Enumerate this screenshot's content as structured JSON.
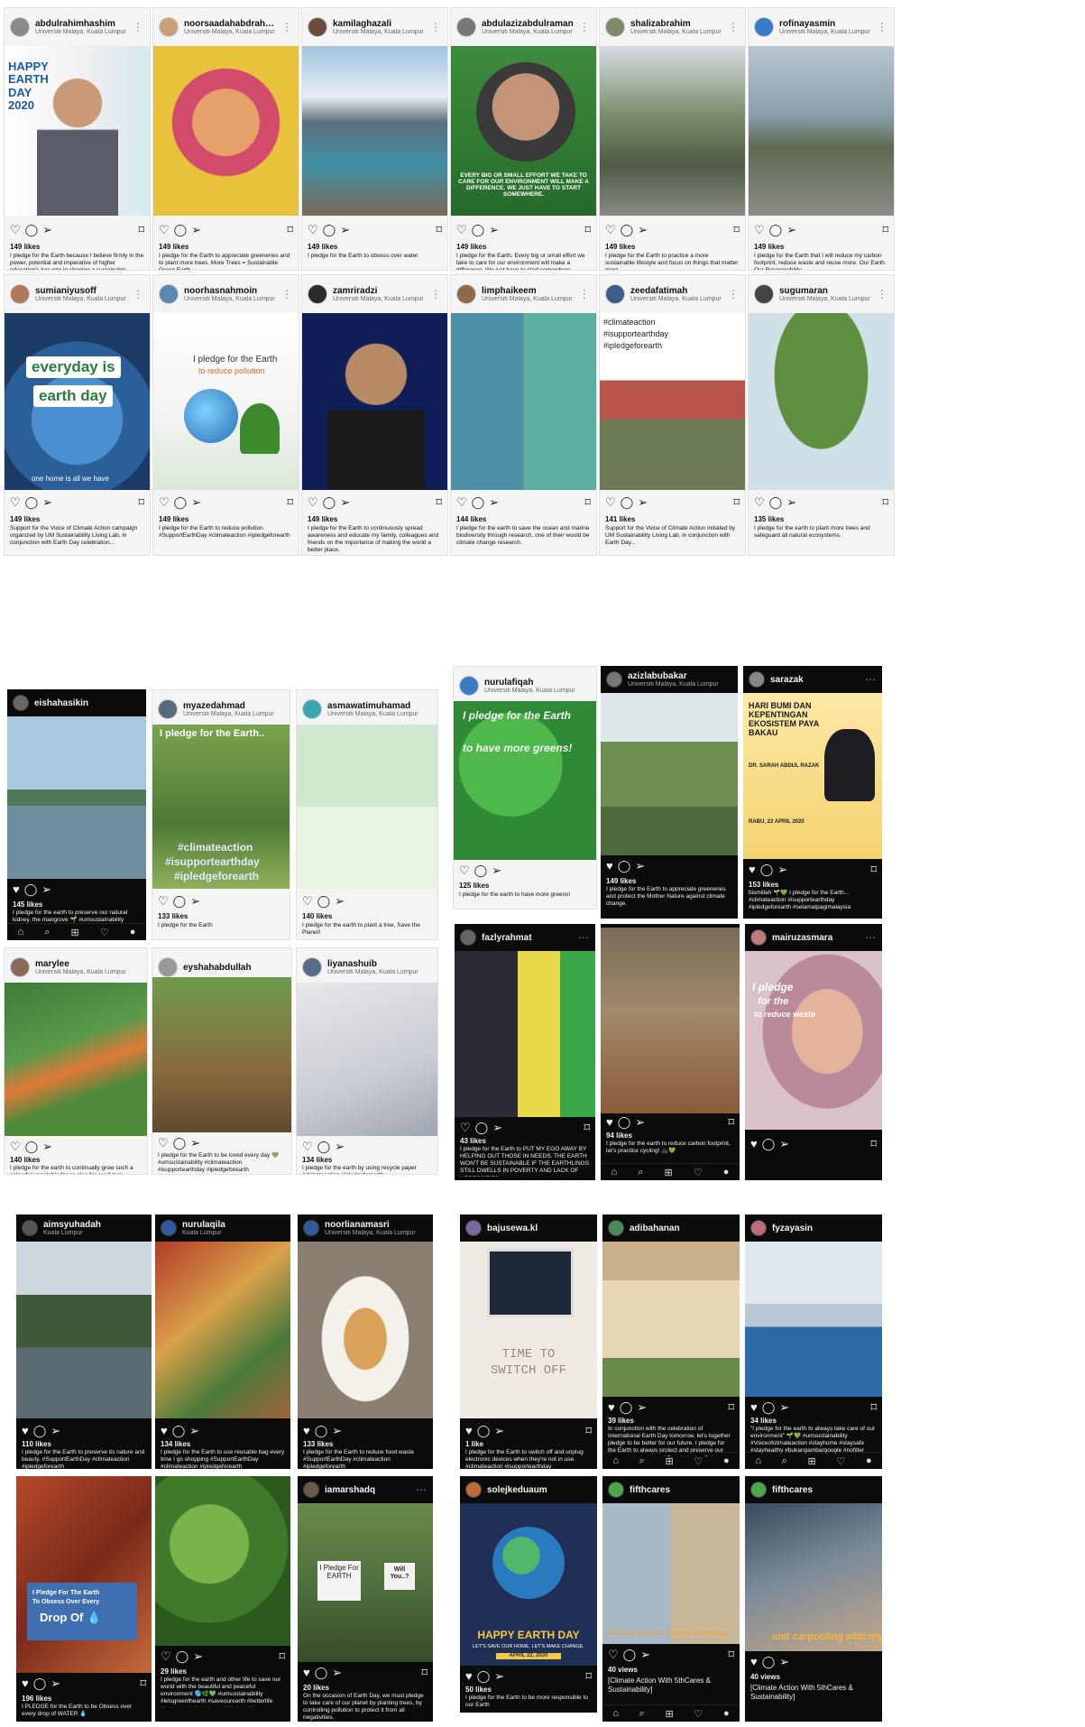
{
  "posts": [
    {
      "user": "abdulrahimhashim",
      "loc": "Universiti Malaya, Kuala Lumpur",
      "likes": "149 likes",
      "cap": "I pledge for the Earth because I believe firmly in the power, potential and imperative of higher education's key role in shaping a sustainable society. I believe that enabling leadership in making the necessary shift towards responsible and sustainable lifestyle is one of our mandates...",
      "overlays": [
        "HAPPY EARTH DAY 2020"
      ]
    },
    {
      "user": "noorsaadahabdrahman",
      "loc": "Universiti Malaya, Kuala Lumpur",
      "likes": "149 likes",
      "cap": "I pledge for the Earth to appreciate greeneries and to plant more trees. More Trees = Sustainable Green Earth",
      "overlays": []
    },
    {
      "user": "kamilaghazali",
      "loc": "Universiti Malaya, Kuala Lumpur",
      "likes": "149 likes",
      "cap": "I pledge for the Earth to obsess over water",
      "overlays": []
    },
    {
      "user": "abdulazizabdulraman",
      "loc": "Universiti Malaya, Kuala Lumpur",
      "likes": "149 likes",
      "cap": "I pledge for the Earth. Every big or small effort we take to care for our environment will make a difference. We just have to start somewhere.",
      "overlays": [
        "EVERY BIG OR SMALL EFFORT WE TAKE TO CARE FOR OUR ENVIRONMENT WILL MAKE A DIFFERENCE. WE JUST HAVE TO START SOMEWHERE."
      ]
    },
    {
      "user": "shalizabrahim",
      "loc": "Universiti Malaya, Kuala Lumpur",
      "likes": "149 likes",
      "cap": "I pledge for the Earth to practice a more sustainable lifestyle and focus on things that matter most.",
      "overlays": []
    },
    {
      "user": "rofinayasmin",
      "loc": "Universiti Malaya, Kuala Lumpur",
      "likes": "149 likes",
      "cap": "I pledge for the Earth that I will reduce my carbon footprint, reduce waste and reuse more. Our Earth. Our Responsibility.",
      "overlays": []
    },
    {
      "user": "sumianiyusoff",
      "loc": "Universiti Malaya, Kuala Lumpur",
      "likes": "149 likes",
      "cap": "Support for the Voice of Climate Action campaign organized by UM Sustainability Living Lab, in conjunction with Earth Day celebration...",
      "overlays": [
        "everyday is",
        "earth day",
        "one home is all we have"
      ]
    },
    {
      "user": "noorhasnahmoin",
      "loc": "Universiti Malaya, Kuala Lumpur",
      "likes": "149 likes",
      "cap": "I pledge for the Earth to reduce pollution. #SupportEarthDay #climateaction #ipledgeforearth",
      "overlays": [
        "I pledge for the Earth",
        "to reduce pollution"
      ]
    },
    {
      "user": "zamriradzi",
      "loc": "Universiti Malaya, Kuala Lumpur",
      "likes": "149 likes",
      "cap": "I pledge for the Earth to continuously spread awareness and educate my family, colleagues and friends on the importance of making the world a better place.",
      "overlays": []
    },
    {
      "user": "limphaikeem",
      "loc": "Universiti Malaya, Kuala Lumpur",
      "likes": "144 likes",
      "cap": "I pledge for the earth to save the ocean and marine biodiversity through research, one of their would be climate change research.",
      "overlays": []
    },
    {
      "user": "zeedafatimah",
      "loc": "Universiti Malaya, Kuala Lumpur",
      "likes": "141 likes",
      "cap": "Support for the Voice of Climate Action initiated by UM Sustainability Living Lab, in conjunction with Earth Day...",
      "overlays": [
        "#climateaction",
        "#isupportearthday",
        "#ipledgeforearth"
      ]
    },
    {
      "user": "sugumaran",
      "loc": "Universiti Malaya, Kuala Lumpur",
      "likes": "135 likes",
      "cap": "I pledge for the earth to plant more trees and safeguard all natural ecosystems.",
      "overlays": []
    },
    {
      "user": "eishahasikin",
      "loc": "",
      "likes": "145 likes",
      "cap": "I pledge for the earth to preserve our natural kidney, the mangrove 🌱 #umsustainability",
      "overlays": []
    },
    {
      "user": "myazedahmad",
      "loc": "Universiti Malaya, Kuala Lumpur",
      "likes": "133 likes",
      "cap": "I pledge for the Earth",
      "overlays": [
        "I pledge for the Earth..",
        "#climateaction",
        "#isupportearthday",
        "#ipledgeforearth"
      ]
    },
    {
      "user": "asmawatimuhamad",
      "loc": "Universiti Malaya, Kuala Lumpur",
      "likes": "140 likes",
      "cap": "I pledge for the earth to plant a tree, Save the Planet!",
      "overlays": []
    },
    {
      "user": "nurulafiqah",
      "loc": "Universiti Malaya, Kuala Lumpur",
      "likes": "125 likes",
      "cap": "I pledge for the earth to have more greens!",
      "overlays": [
        "I pledge for the Earth",
        "to have more greens!"
      ]
    },
    {
      "user": "azizlabubakar",
      "loc": "Universiti Malaya, Kuala Lumpur",
      "likes": "149 likes",
      "cap": "I pledge for the Earth to appreciate greeneries and protect the Mother Nature against climate change.",
      "overlays": []
    },
    {
      "user": "sarazak",
      "loc": "",
      "likes": "153 likes",
      "cap": "bismillah 🌱💚 I pledge for the Earth... #climateaction #isupportearthday #ipledgeforearth #selamatpagimalaysia",
      "overlays": [
        "HARI BUMI DAN KEPENTINGAN EKOSISTEM PAYA BAKAU",
        "DR. SARAH ABDUL RAZAK",
        "RABU, 22 APRIL 2020"
      ]
    },
    {
      "user": "marylee",
      "loc": "Universiti Malaya, Kuala Lumpur",
      "likes": "140 likes",
      "cap": "I pledge for the earth to continually grow such a colourful vegetable for us also for our future generations!",
      "overlays": []
    },
    {
      "user": "eyshahabdullah",
      "loc": "",
      "likes": "",
      "cap": "I pledge for the Earth to be loved every day 💚 #umsustainability #climateaction #isupportearthday #ipledgeforearth",
      "overlays": []
    },
    {
      "user": "liyanashuib",
      "loc": "Universiti Malaya, Kuala Lumpur",
      "likes": "134 likes",
      "cap": "I pledge for the earth by using recycle paper #climateaction #ipledgeforearth #isupportEarthday",
      "overlays": []
    },
    {
      "user": "fazlyrahmat",
      "loc": "",
      "likes": "43 likes",
      "cap": "I pledge for the Earth to PUT MY EGO AWAY BY HELPING OUT THOSE IN NEEDS. THE EARTH WON'T BE SUSTAINABLE IF THE EARTHLINGS STILL DWELLS IN POVERTY AND LACK OF NECESSITIES.",
      "overlays": []
    },
    {
      "user": "",
      "loc": "",
      "likes": "94 likes",
      "cap": "I pledge for the earth to reduce carbon footprint, let's practice cycling! 🚲💚",
      "overlays": []
    },
    {
      "user": "mairuzasmara",
      "loc": "",
      "likes": "",
      "cap": "",
      "overlays": [
        "I pledge",
        "for the",
        "to reduce waste"
      ]
    },
    {
      "user": "aimsyuhadah",
      "loc": "Kuala Lumpur",
      "likes": "110 likes",
      "cap": "I pledge for the Earth to preserve its nature and beauty. #SupportEarthDay #climateaction #ipledgeforearth",
      "overlays": []
    },
    {
      "user": "nurulaqila",
      "loc": "Kuala Lumpur",
      "likes": "134 likes",
      "cap": "I pledge for the Earth to use reusable bag every time I go shopping #SupportEarthDay #climateaction #ipledgeforearth",
      "overlays": []
    },
    {
      "user": "noorlianamasri",
      "loc": "Universiti Malaya, Kuala Lumpur",
      "likes": "133 likes",
      "cap": "I pledge for the Earth to reduce food waste #SupportEarthDay #climateaction #ipledgeforearth",
      "overlays": []
    },
    {
      "user": "bajusewa.kl",
      "loc": "",
      "likes": "1 like",
      "cap": "I pledge for the Earth to switch off and unplug electronic devices when they're not in use. #climateaction #isupportearthday #ipledgeforearth",
      "overlays": [
        "TIME TO",
        "SWITCH OFF"
      ]
    },
    {
      "user": "adibahanan",
      "loc": "",
      "likes": "39 likes",
      "cap": "In conjunction with the celebration of International Earth Day tomorrow, let's together pledge to be better for our future. I pledge for the Earth to always protect and preserve our mangrove ecosystem! Eco-rinduniya Pulau Kukup 🌱💚 #climateaction #isupportearthday #ipledgeforearth",
      "overlays": []
    },
    {
      "user": "fyzayasin",
      "loc": "",
      "likes": "34 likes",
      "cap": "\"I pledge for the earth to always take care of our environment\" 🌱💚 #umsustainability #Voiceofclimateaction #stayhome #staysafe #stayhealthy #bukangambargoogle #nofilter",
      "overlays": []
    },
    {
      "user": "",
      "loc": "",
      "likes": "196 likes",
      "cap": "I PLEDGE for the Earth to be Obsess over every drop of WATER 💧",
      "overlays": [
        "I Pledge For The Earth",
        "To Obsess Over Every",
        "Drop Of 💧"
      ]
    },
    {
      "user": "",
      "loc": "",
      "likes": "29 likes",
      "cap": "I pledge for the earth and other life to save our world with the beautiful and peaceful environment 🌎🌿💚 #umsustainability #letsgreenthearth #saveourearth #betterlife #betterearth #stayhome #kitajagakita #kitamestimenang",
      "overlays": []
    },
    {
      "user": "iamarshadq",
      "loc": "",
      "likes": "20 likes",
      "cap": "On the occasion of Earth Day, we must pledge to take care of our planet by planting trees, by controlling pollution to protect it from all negativities.",
      "overlays": [
        "I Pledge For EARTH",
        "Will You..?"
      ]
    },
    {
      "user": "solejkeduaum",
      "loc": "",
      "likes": "50 likes",
      "cap": "I pledge for the Earth to be more responsible to our Earth",
      "overlays": [
        "HAPPY EARTH DAY",
        "LET'S SAVE OUR HOME. LET'S MAKE CHANGE.",
        "APRIL 22, 2020"
      ]
    },
    {
      "user": "fifthcares",
      "loc": "",
      "likes": "40 views",
      "cap": "[Climate Action With 5thCares & Sustainability]",
      "overlays": [
        "Reusable bags for grocery & shopping"
      ]
    },
    {
      "user": "fifthcares",
      "loc": "",
      "likes": "40 views",
      "cap": "[Climate Action With 5thCares & Sustainability]",
      "overlays": [
        "and carpooling with my"
      ]
    }
  ],
  "icons": {
    "heart": "heart-icon",
    "comment": "comment-icon",
    "share": "share-icon",
    "bookmark": "bookmark-icon"
  },
  "colors": {
    "like_red": "#e0245e",
    "dark_bg": "#0b0b0b",
    "light_bg": "#f4f4f4"
  }
}
